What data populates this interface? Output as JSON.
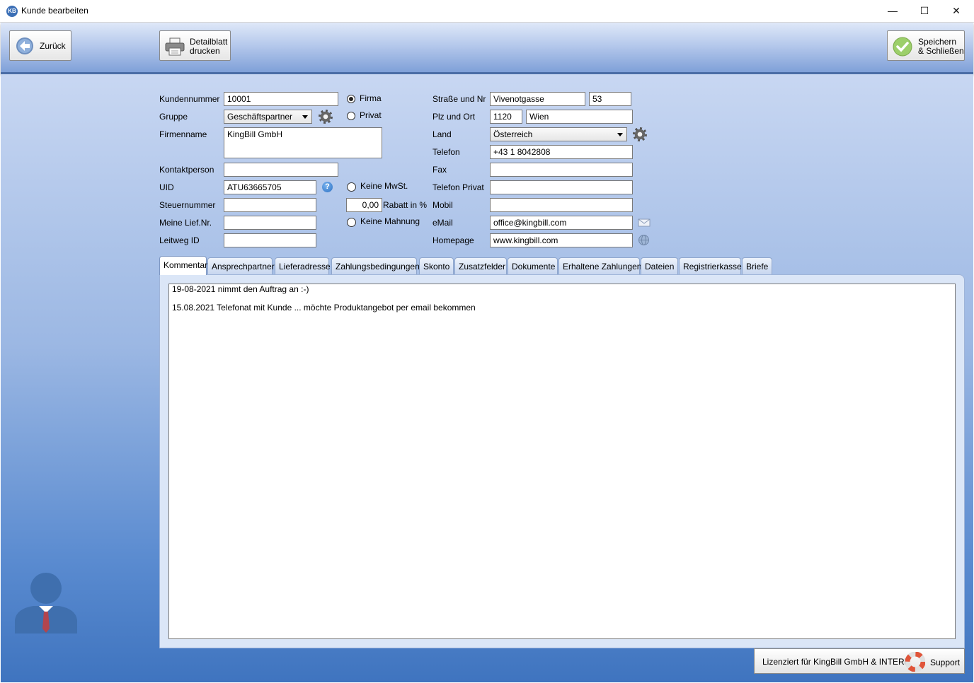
{
  "window": {
    "icon_text": "KB",
    "title": "Kunde bearbeiten",
    "minimize": "—",
    "maximize": "☐",
    "close": "✕"
  },
  "toolbar": {
    "back_label": "Zurück",
    "print_label_1": "Detailblatt",
    "print_label_2": "drucken",
    "save_label_1": "Speichern",
    "save_label_2": "& Schließen"
  },
  "form": {
    "customer_number_label": "Kundennummer",
    "customer_number": "10001",
    "group_label": "Gruppe",
    "group_value": "Geschäftspartner",
    "company_name_label": "Firmenname",
    "company_name": "KingBill GmbH",
    "contact_label": "Kontaktperson",
    "contact": "",
    "uid_label": "UID",
    "uid": "ATU63665705",
    "tax_number_label": "Steuernummer",
    "tax_number": "",
    "supplier_nr_label": "Meine Lief.Nr.",
    "supplier_nr": "",
    "leitweg_label": "Leitweg ID",
    "leitweg": "",
    "type_company_label": "Firma",
    "type_private_label": "Privat",
    "no_vat_label": "Keine MwSt.",
    "discount_value": "0,00",
    "discount_label": "Rabatt in %",
    "no_dunning_label": "Keine Mahnung",
    "street_label": "Straße und Nr",
    "street": "Vivenotgasse",
    "house_number": "53",
    "zip_city_label": "Plz und Ort",
    "zip": "1120",
    "city": "Wien",
    "country_label": "Land",
    "country": "Österreich",
    "phone_label": "Telefon",
    "phone": "+43 1 8042808",
    "fax_label": "Fax",
    "fax": "",
    "phone_private_label": "Telefon Privat",
    "phone_private": "",
    "mobile_label": "Mobil",
    "mobile": "",
    "email_label": "eMail",
    "email": "office@kingbill.com",
    "homepage_label": "Homepage",
    "homepage": "www.kingbill.com",
    "help_icon": "?"
  },
  "tabs": [
    {
      "label": "Kommentar"
    },
    {
      "label": "Ansprechpartner"
    },
    {
      "label": "Lieferadresse"
    },
    {
      "label": "Zahlungsbedingungen"
    },
    {
      "label": "Skonto"
    },
    {
      "label": "Zusatzfelder"
    },
    {
      "label": "Dokumente"
    },
    {
      "label": "Erhaltene Zahlungen"
    },
    {
      "label": "Dateien"
    },
    {
      "label": "Registrierkasse"
    },
    {
      "label": "Briefe"
    }
  ],
  "comment": {
    "lines": [
      "19-08-2021 nimmt den Auftrag an :-)",
      "",
      "15.08.2021 Telefonat mit Kunde ... möchte Produktangebot per email bekommen"
    ]
  },
  "footer": {
    "license": "Lizenziert für KingBill GmbH & INTERN",
    "support": "Support"
  },
  "icons": {
    "back": "arrow-left-icon",
    "print": "printer-icon",
    "save": "checkmark-icon",
    "settings": "gear-icon",
    "help": "help-icon",
    "email": "email-icon",
    "web": "globe-icon",
    "avatar": "person-icon",
    "support": "lifebuoy-icon"
  }
}
